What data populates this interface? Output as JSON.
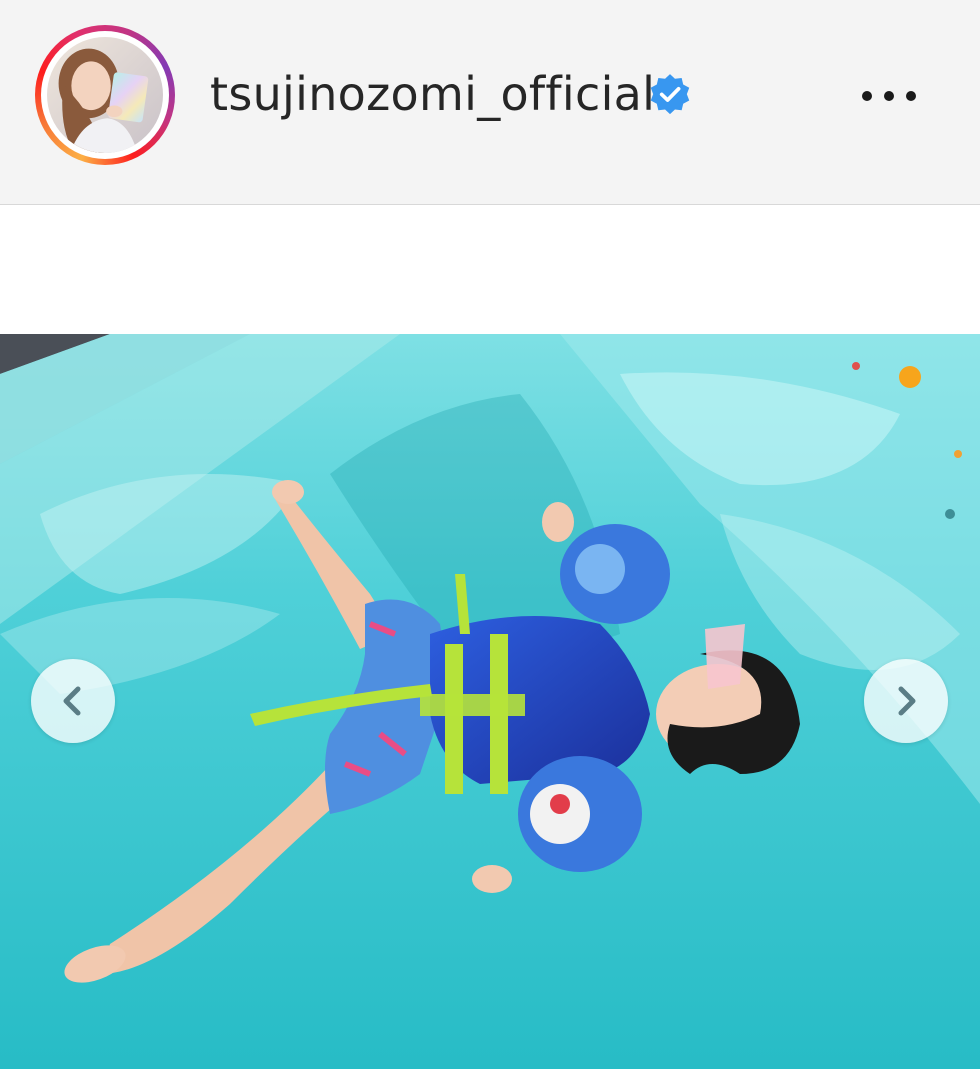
{
  "post": {
    "username": "tsujinozomi_official",
    "verified": true,
    "avatar_icon": "profile-photo",
    "more_icon": "more-options-icon"
  },
  "media": {
    "description_icon": "photo-child-floating-in-pool",
    "prev_icon": "chevron-left-icon",
    "next_icon": "chevron-right-icon"
  },
  "colors": {
    "ring_start": "#fcaf45",
    "ring_end": "#833ab4",
    "verified_blue": "#3897f0",
    "pool_water": "#3ec9d2",
    "nav_arrow": "#5a7d86"
  }
}
